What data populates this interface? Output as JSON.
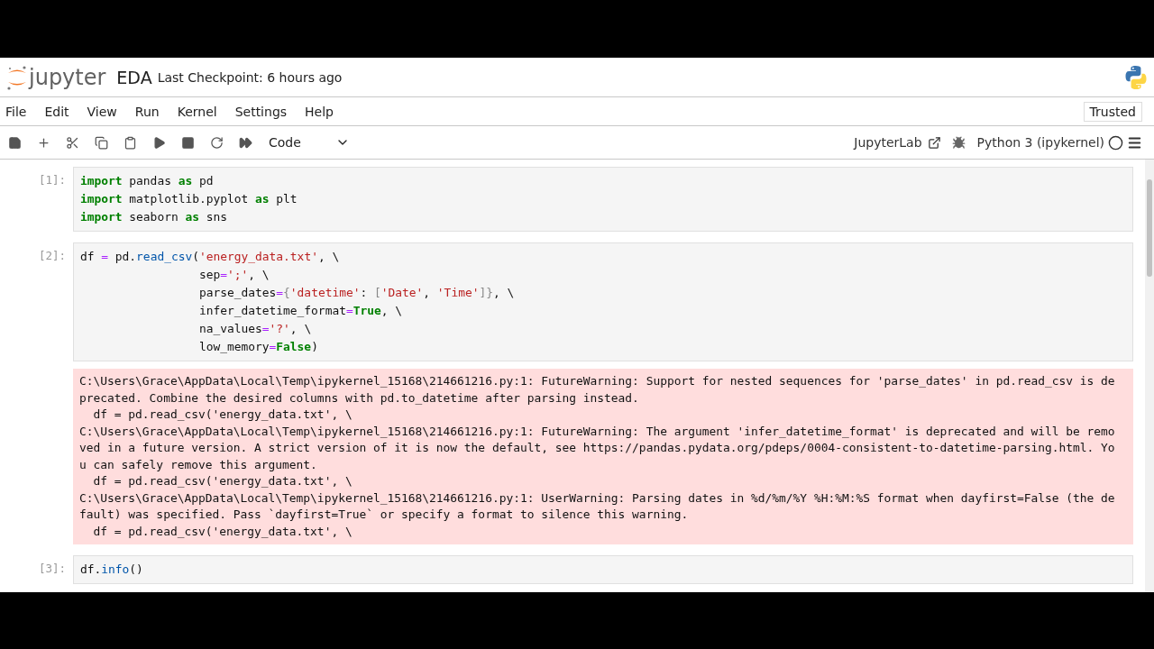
{
  "header": {
    "logo_text": "jupyter",
    "notebook_name": "EDA",
    "checkpoint": "Last Checkpoint: 6 hours ago"
  },
  "menu": [
    {
      "label": "File"
    },
    {
      "label": "Edit"
    },
    {
      "label": "View"
    },
    {
      "label": "Run"
    },
    {
      "label": "Kernel"
    },
    {
      "label": "Settings"
    },
    {
      "label": "Help"
    }
  ],
  "trusted": "Trusted",
  "toolbar": {
    "cell_type": "Code",
    "jupyterlab": "JupyterLab",
    "kernel": "Python 3 (ipykernel)"
  },
  "cells": [
    {
      "prompt": "[1]:",
      "lines": [
        [
          {
            "kind": "kw",
            "text": "import"
          },
          {
            "kind": "plain",
            "text": " pandas "
          },
          {
            "kind": "kw",
            "text": "as"
          },
          {
            "kind": "plain",
            "text": " pd"
          }
        ],
        [
          {
            "kind": "kw",
            "text": "import"
          },
          {
            "kind": "plain",
            "text": " matplotlib.pyplot "
          },
          {
            "kind": "kw",
            "text": "as"
          },
          {
            "kind": "plain",
            "text": " plt"
          }
        ],
        [
          {
            "kind": "kw",
            "text": "import"
          },
          {
            "kind": "plain",
            "text": " seaborn "
          },
          {
            "kind": "kw",
            "text": "as"
          },
          {
            "kind": "plain",
            "text": " sns"
          }
        ]
      ]
    },
    {
      "prompt": "[2]:",
      "lines": [
        [
          {
            "kind": "plain",
            "text": "df "
          },
          {
            "kind": "op",
            "text": "="
          },
          {
            "kind": "plain",
            "text": " pd."
          },
          {
            "kind": "fn",
            "text": "read_csv"
          },
          {
            "kind": "plain",
            "text": "("
          },
          {
            "kind": "str",
            "text": "'energy_data.txt'"
          },
          {
            "kind": "plain",
            "text": ", \\"
          }
        ],
        [
          {
            "kind": "plain",
            "text": "                 sep"
          },
          {
            "kind": "op",
            "text": "="
          },
          {
            "kind": "str",
            "text": "';'"
          },
          {
            "kind": "plain",
            "text": ", \\"
          }
        ],
        [
          {
            "kind": "plain",
            "text": "                 parse_dates"
          },
          {
            "kind": "op",
            "text": "="
          },
          {
            "kind": "punct",
            "text": "{"
          },
          {
            "kind": "str",
            "text": "'datetime'"
          },
          {
            "kind": "plain",
            "text": ": "
          },
          {
            "kind": "punct",
            "text": "["
          },
          {
            "kind": "str",
            "text": "'Date'"
          },
          {
            "kind": "plain",
            "text": ", "
          },
          {
            "kind": "str",
            "text": "'Time'"
          },
          {
            "kind": "punct",
            "text": "]}"
          },
          {
            "kind": "plain",
            "text": ", \\"
          }
        ],
        [
          {
            "kind": "plain",
            "text": "                 infer_datetime_format"
          },
          {
            "kind": "op",
            "text": "="
          },
          {
            "kind": "kw",
            "text": "True"
          },
          {
            "kind": "plain",
            "text": ", \\"
          }
        ],
        [
          {
            "kind": "plain",
            "text": "                 na_values"
          },
          {
            "kind": "op",
            "text": "="
          },
          {
            "kind": "str",
            "text": "'?'"
          },
          {
            "kind": "plain",
            "text": ", \\"
          }
        ],
        [
          {
            "kind": "plain",
            "text": "                 low_memory"
          },
          {
            "kind": "op",
            "text": "="
          },
          {
            "kind": "kw",
            "text": "False"
          },
          {
            "kind": "plain",
            "text": ")"
          }
        ]
      ],
      "output": {
        "kind": "stderr",
        "lines": [
          "C:\\Users\\Grace\\AppData\\Local\\Temp\\ipykernel_15168\\214661216.py:1: FutureWarning: Support for nested sequences for 'parse_dates' in pd.read_csv is de",
          "precated. Combine the desired columns with pd.to_datetime after parsing instead.",
          "  df = pd.read_csv('energy_data.txt', \\",
          "C:\\Users\\Grace\\AppData\\Local\\Temp\\ipykernel_15168\\214661216.py:1: FutureWarning: The argument 'infer_datetime_format' is deprecated and will be remo",
          "ved in a future version. A strict version of it is now the default, see https://pandas.pydata.org/pdeps/0004-consistent-to-datetime-parsing.html. Yo",
          "u can safely remove this argument.",
          "  df = pd.read_csv('energy_data.txt', \\",
          "C:\\Users\\Grace\\AppData\\Local\\Temp\\ipykernel_15168\\214661216.py:1: UserWarning: Parsing dates in %d/%m/%Y %H:%M:%S format when dayfirst=False (the de",
          "fault) was specified. Pass `dayfirst=True` or specify a format to silence this warning.",
          "  df = pd.read_csv('energy_data.txt', \\"
        ]
      }
    },
    {
      "prompt": "[3]:",
      "lines": [
        [
          {
            "kind": "plain",
            "text": "df."
          },
          {
            "kind": "fn",
            "text": "info"
          },
          {
            "kind": "plain",
            "text": "()"
          }
        ]
      ]
    }
  ]
}
